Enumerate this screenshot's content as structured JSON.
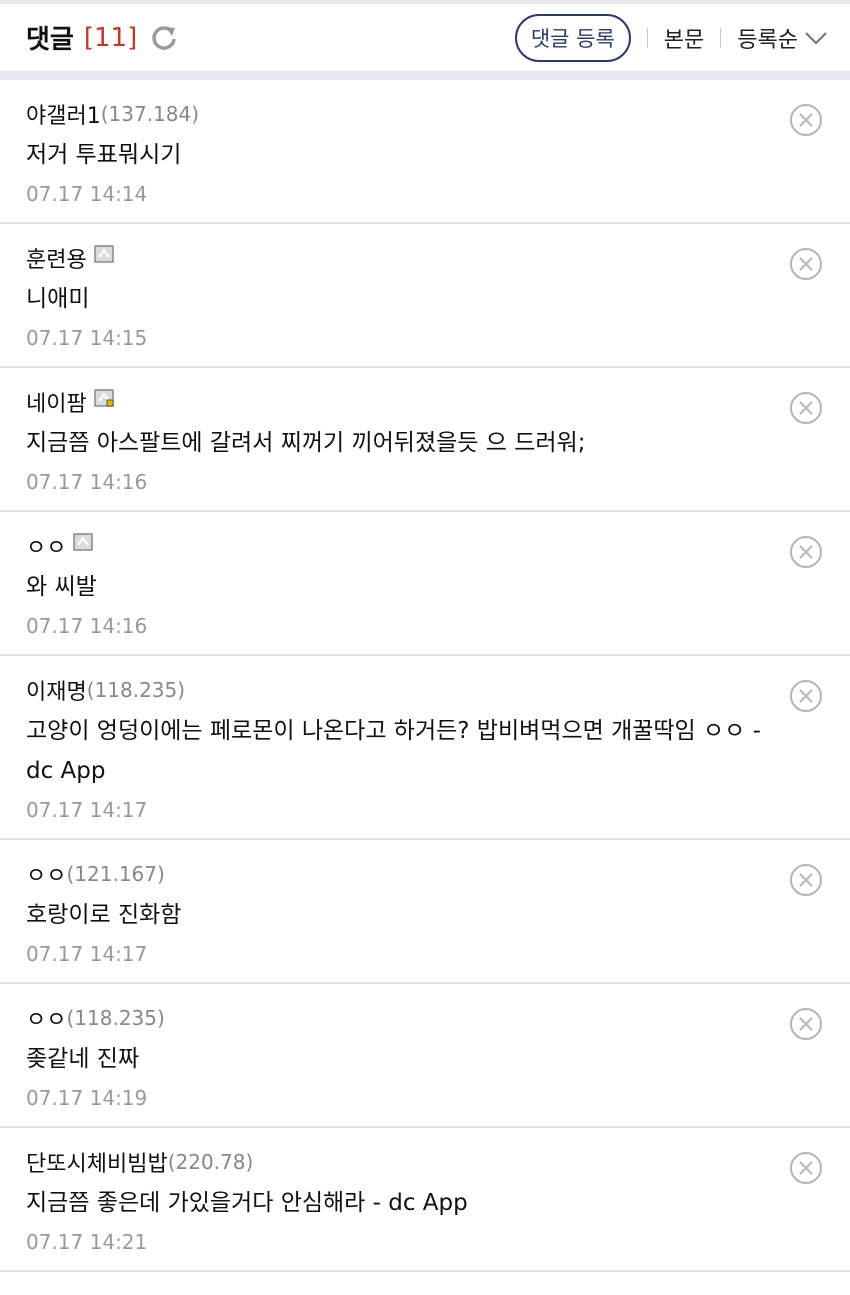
{
  "header": {
    "title": "댓글",
    "count": "[11]",
    "register_label": "댓글 등록",
    "body_link": "본문",
    "sort_label": "등록순",
    "refresh_icon": "refresh-icon",
    "sort_icon": "chevron-down-icon"
  },
  "colors": {
    "count": "#c0392b",
    "button_border": "#2d3a6b",
    "divider": "#e6e7ef"
  },
  "comments": [
    {
      "author": "야갤러1",
      "ip": "(137.184)",
      "text": "저거 투표뭐시기",
      "date": "07.17 14:14",
      "member_icon": false
    },
    {
      "author": "훈련용",
      "ip": "",
      "text": "니애미",
      "date": "07.17 14:15",
      "member_icon": true
    },
    {
      "author": "네이팜",
      "ip": "",
      "text": "지금쯤 아스팔트에 갈려서 찌꺼기 끼어뒤졌을듯 으 드러워;",
      "date": "07.17 14:16",
      "member_icon": true
    },
    {
      "author": "ㅇㅇ",
      "ip": "",
      "text": "와 씨발",
      "date": "07.17 14:16",
      "member_icon": true
    },
    {
      "author": "이재명",
      "ip": "(118.235)",
      "text": "고양이 엉덩이에는 페로몬이 나온다고 하거든? 밥비벼먹으면 개꿀딱임 ㅇㅇ - dc App",
      "date": "07.17 14:17",
      "member_icon": false
    },
    {
      "author": "ㅇㅇ",
      "ip": "(121.167)",
      "text": "호랑이로 진화함",
      "date": "07.17 14:17",
      "member_icon": false
    },
    {
      "author": "ㅇㅇ",
      "ip": "(118.235)",
      "text": "좆같네 진짜",
      "date": "07.17 14:19",
      "member_icon": false
    },
    {
      "author": "단또시체비빔밥",
      "ip": "(220.78)",
      "text": "지금쯤 좋은데 가있을거다 안심해라 - dc App",
      "date": "07.17 14:21",
      "member_icon": false
    }
  ]
}
